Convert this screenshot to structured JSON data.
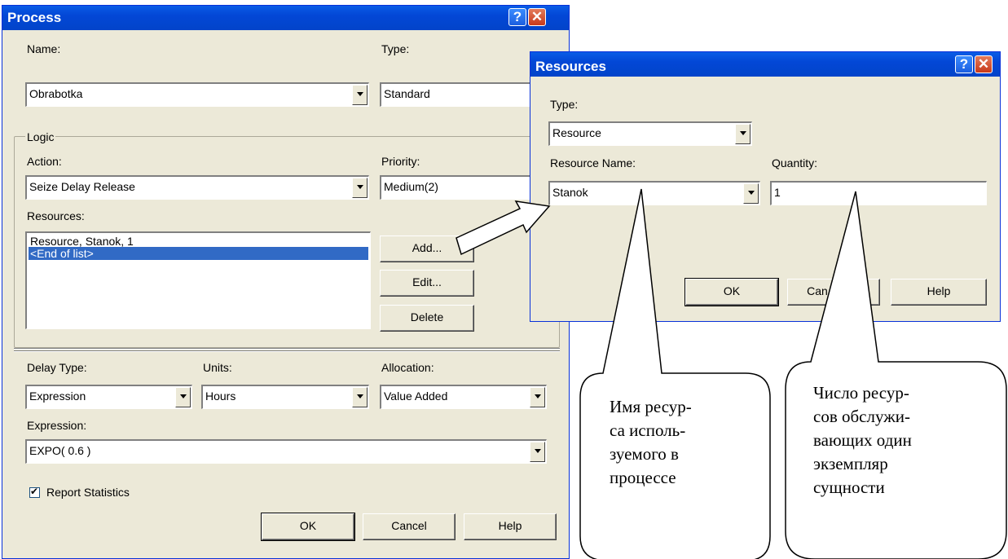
{
  "process": {
    "title": "Process",
    "name_label": "Name:",
    "name_value": "Obrabotka",
    "type_label": "Type:",
    "type_value": "Standard",
    "logic_group": "Logic",
    "action_label": "Action:",
    "action_value": "Seize Delay Release",
    "priority_label": "Priority:",
    "priority_value": "Medium(2)",
    "resources_label": "Resources:",
    "resources_items": [
      "Resource, Stanok, 1",
      "<End of list>"
    ],
    "add_label": "Add...",
    "edit_label": "Edit...",
    "delete_label": "Delete",
    "delay_type_label": "Delay Type:",
    "delay_type_value": "Expression",
    "units_label": "Units:",
    "units_value": "Hours",
    "allocation_label": "Allocation:",
    "allocation_value": "Value Added",
    "expression_label": "Expression:",
    "expression_value": "EXPO( 0.6 )",
    "report_stats_label": "Report Statistics",
    "report_stats_checked": true,
    "ok_label": "OK",
    "cancel_label": "Cancel",
    "help_label": "Help"
  },
  "resources_dialog": {
    "title": "Resources",
    "type_label": "Type:",
    "type_value": "Resource",
    "resource_name_label": "Resource Name:",
    "resource_name_value": "Stanok",
    "quantity_label": "Quantity:",
    "quantity_value": "1",
    "ok_label": "OK",
    "cancel_label": "Can",
    "help_label": "Help"
  },
  "callouts": {
    "left_lines": [
      "Имя ресур-",
      "са исполь-",
      "зуемого в",
      "процессе"
    ],
    "right_lines": [
      "Число ресур-",
      "сов обслужи-",
      "вающих один",
      "экземпляр",
      "сущности"
    ]
  }
}
